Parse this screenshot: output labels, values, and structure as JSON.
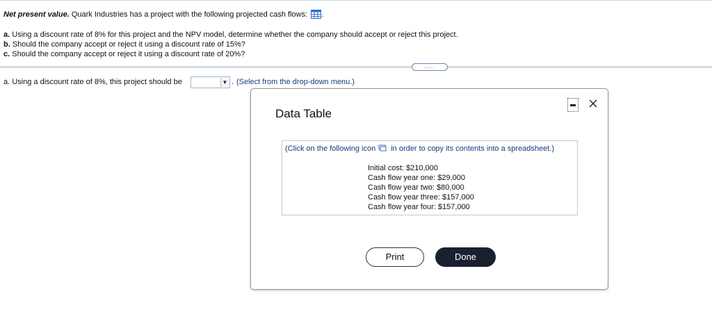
{
  "question": {
    "title_bold": "Net present value.",
    "title_text": " Quark Industries has a project with the following projected cash flows: ",
    "title_suffix": ".",
    "parts": [
      {
        "label": "a.",
        "text": " Using a discount rate of 8% for this project and the NPV model, determine whether the company should accept or reject this project."
      },
      {
        "label": "b.",
        "text": " Should the company accept or reject it using a discount rate of 15%?"
      },
      {
        "label": "c.",
        "text": " Should the company accept or reject it using a discount rate of 20%?"
      }
    ],
    "expand_label": "....."
  },
  "answer": {
    "prompt": "a. Using a discount rate of 8%, this project should be",
    "selected_value": "",
    "suffix": ".",
    "hint": "(Select from the drop-down menu.)"
  },
  "modal": {
    "title": "Data Table",
    "copy_note_before": "(Click on the following icon",
    "copy_note_after": "in order to copy its contents into a spreadsheet.)",
    "cash_flows": [
      "Initial cost: $210,000",
      "Cash flow year one: $29,000",
      "Cash flow year two: $80,000",
      "Cash flow year three: $157,000",
      "Cash flow year four: $157,000"
    ],
    "print_label": "Print",
    "done_label": "Done"
  },
  "colors": {
    "link_blue": "#1a3a7a",
    "done_bg": "#1a2030",
    "grid_icon": "#2a6fd6"
  },
  "icons": [
    "table-grid-icon",
    "dropdown-arrow-icon",
    "minimize-icon",
    "close-icon",
    "copy-icon"
  ]
}
